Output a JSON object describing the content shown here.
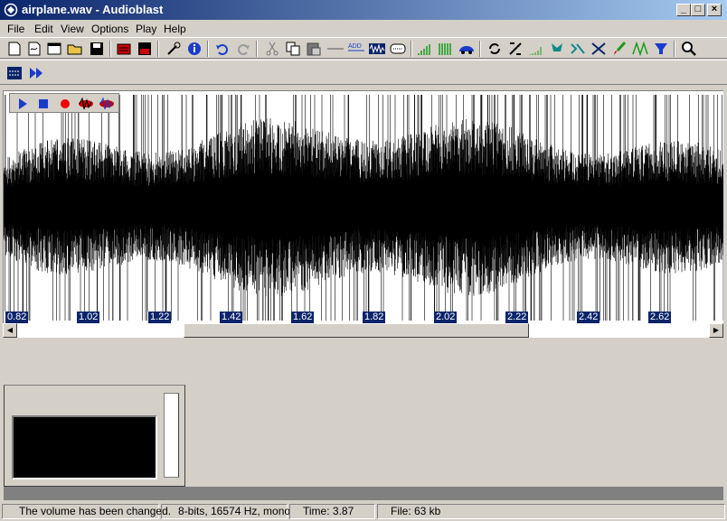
{
  "window": {
    "title": "airplane.wav - Audioblast"
  },
  "title_buttons": {
    "minimize": "_",
    "maximize": "□",
    "close": "×"
  },
  "menu": [
    {
      "label": "File"
    },
    {
      "label": "Edit"
    },
    {
      "label": "View"
    },
    {
      "label": "Options"
    },
    {
      "label": "Play"
    },
    {
      "label": "Help"
    }
  ],
  "toolbar": {
    "icons": [
      "new-icon",
      "open-icon",
      "new-window-icon",
      "folder-open-icon",
      "save-icon",
      "record-file-icon",
      "save-as-icon",
      "magic-wand-icon",
      "info-icon",
      "undo-icon",
      "redo-icon",
      "cut-icon",
      "copy-icon",
      "paste-icon",
      "line-icon",
      "add-icon",
      "waveform-icon",
      "mix-icon",
      "fade-in-icon",
      "amplify-icon",
      "car-icon",
      "loop-icon",
      "reverse-icon",
      "fade-out-icon",
      "tree-icon",
      "echo-icon",
      "filter-icon",
      "brush-icon",
      "zigzag-icon",
      "funnel-icon",
      "zoom-icon"
    ]
  },
  "toolbar2": {
    "icons": [
      "select-all-icon",
      "fast-forward-icon"
    ]
  },
  "transport": {
    "icons": [
      "play-icon",
      "stop-icon",
      "record-icon",
      "record-left-icon",
      "record-right-icon"
    ]
  },
  "timeline": {
    "labels": [
      "0.82",
      "1.02",
      "1.22",
      "1.42",
      "1.62",
      "1.82",
      "2.02",
      "2.22",
      "2.42",
      "2.62"
    ]
  },
  "scroll": {
    "position": 0.24,
    "thumb_fraction": 0.5
  },
  "status": {
    "message": "The volume has been changed.",
    "format": "8-bits, 16574 Hz, mono",
    "time": "Time: 3.87",
    "file": "File: 63 kb"
  },
  "colors": {
    "titlebar_start": "#0a246a",
    "titlebar_end": "#a6caf0",
    "timeline_label_bg": "#0a246a",
    "waveform": "#000000"
  }
}
